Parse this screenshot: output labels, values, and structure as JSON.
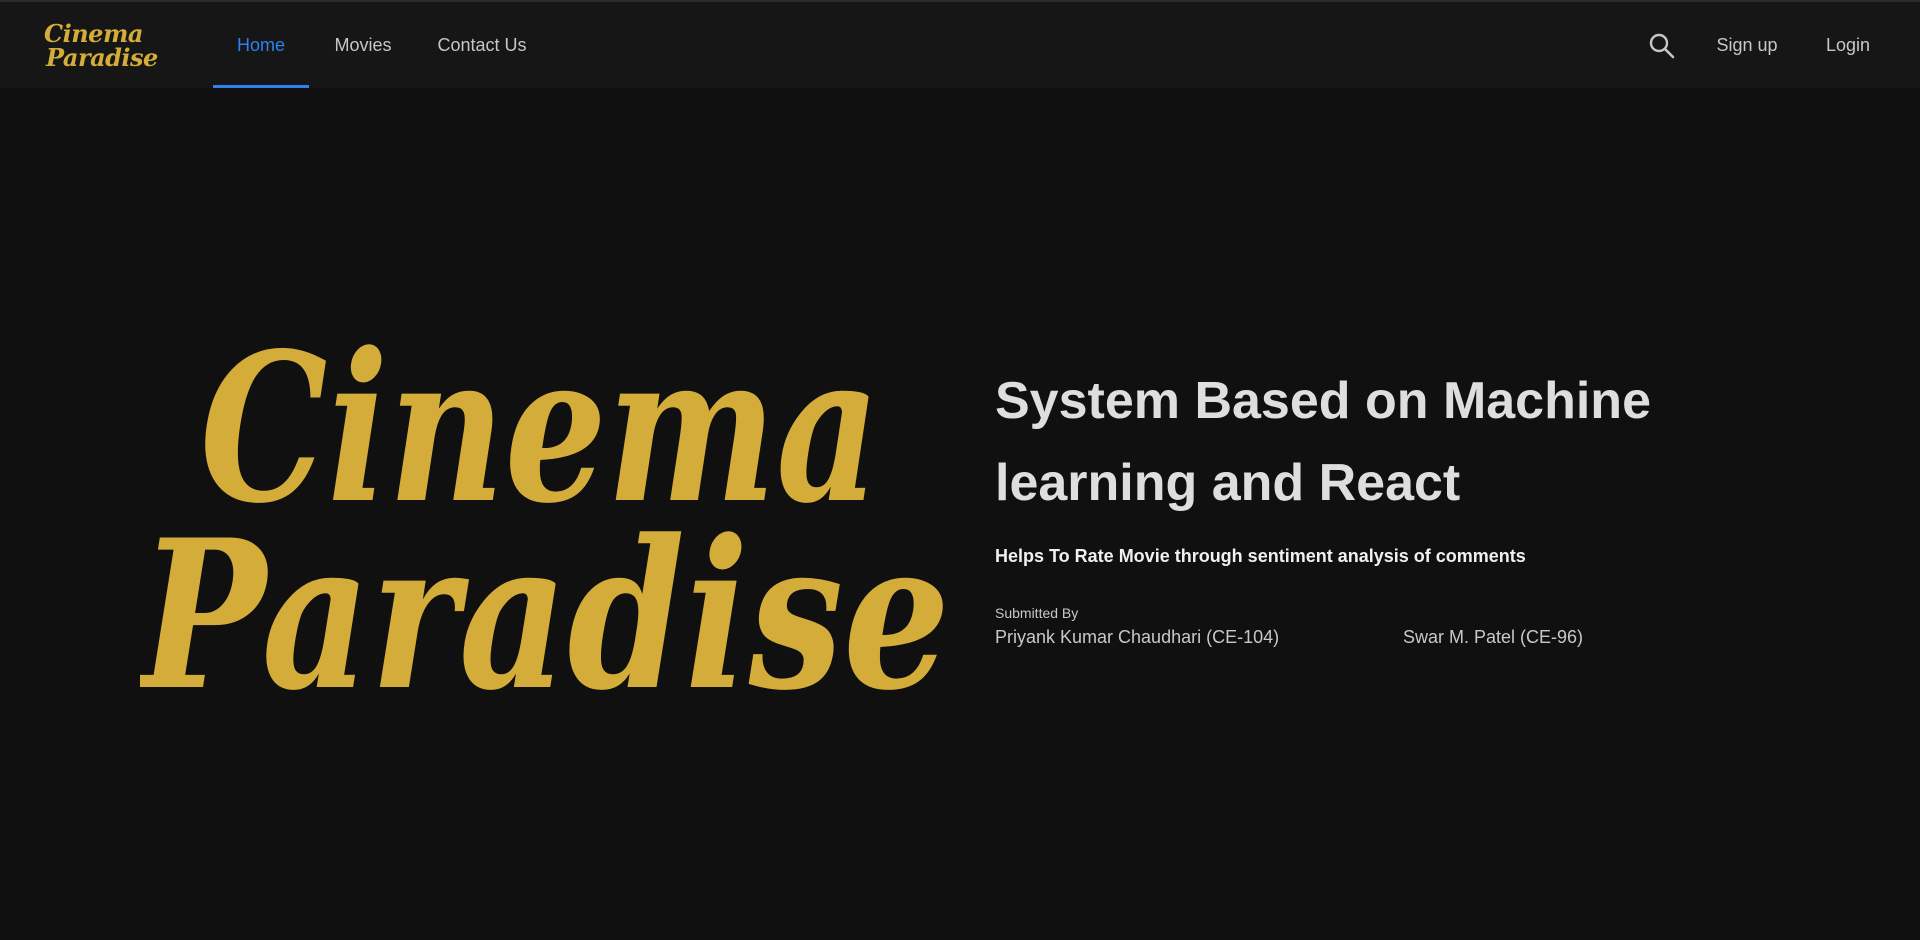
{
  "nav": {
    "brand": {
      "line1": "Cinema",
      "line2": "Paradise"
    },
    "links": [
      {
        "label": "Home",
        "active": true
      },
      {
        "label": "Movies",
        "active": false
      },
      {
        "label": "Contact Us",
        "active": false
      }
    ],
    "search_icon": "search-icon",
    "signup_label": "Sign up",
    "login_label": "Login"
  },
  "hero": {
    "logo": {
      "line1": "Cinema",
      "line2": "Paradise"
    },
    "title_line1": "System Based on Machine",
    "title_line2": "learning and React",
    "subtitle": "Helps To Rate Movie through sentiment analysis of comments",
    "submitted_by_label": "Submitted By",
    "authors": [
      "Priyank Kumar Chaudhari (CE-104)",
      "Swar M. Patel (CE-96)"
    ]
  },
  "colors": {
    "background": "#101010",
    "navbar": "#161616",
    "brand_gold": "#d4ac39",
    "active_blue": "#2f80ed",
    "nav_text": "#c6c6c6",
    "hero_title": "#dedede"
  }
}
